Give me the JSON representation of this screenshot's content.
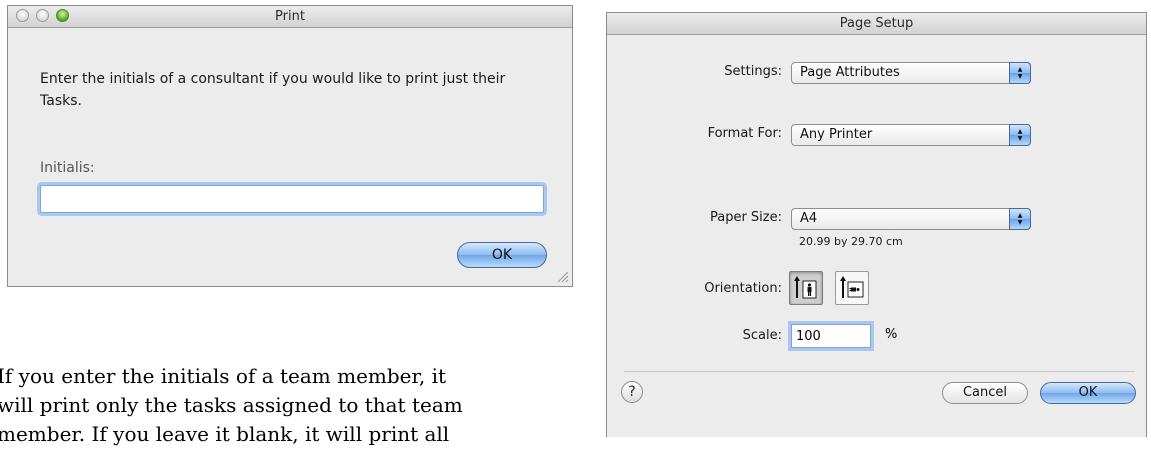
{
  "print_dialog": {
    "title": "Print",
    "message": "Enter the initials of a consultant if you would like to print just their Tasks.",
    "field_label": "Initialis:",
    "field_value": "",
    "ok_label": "OK"
  },
  "page_setup": {
    "title": "Page Setup",
    "settings_label": "Settings:",
    "settings_value": "Page Attributes",
    "format_label": "Format For:",
    "format_value": "Any Printer",
    "paper_label": "Paper Size:",
    "paper_value": "A4",
    "paper_dimensions": "20.99 by 29.70 cm",
    "orientation_label": "Orientation:",
    "orientation_selected": "portrait",
    "scale_label": "Scale:",
    "scale_value": "100",
    "scale_unit": "%",
    "help_label": "?",
    "cancel_label": "Cancel",
    "ok_label": "OK"
  },
  "document_text": {
    "lines": [
      "If you enter the initials of a team member, it",
      "will print only the tasks assigned to that team",
      "member. If you leave it blank, it will print all"
    ]
  },
  "colors": {
    "focus_ring": "#a9c8ef",
    "default_button": "#6fa8ea"
  },
  "icons": [
    "resize-grip-icon",
    "portrait-orientation-icon",
    "landscape-orientation-icon",
    "help-icon"
  ]
}
